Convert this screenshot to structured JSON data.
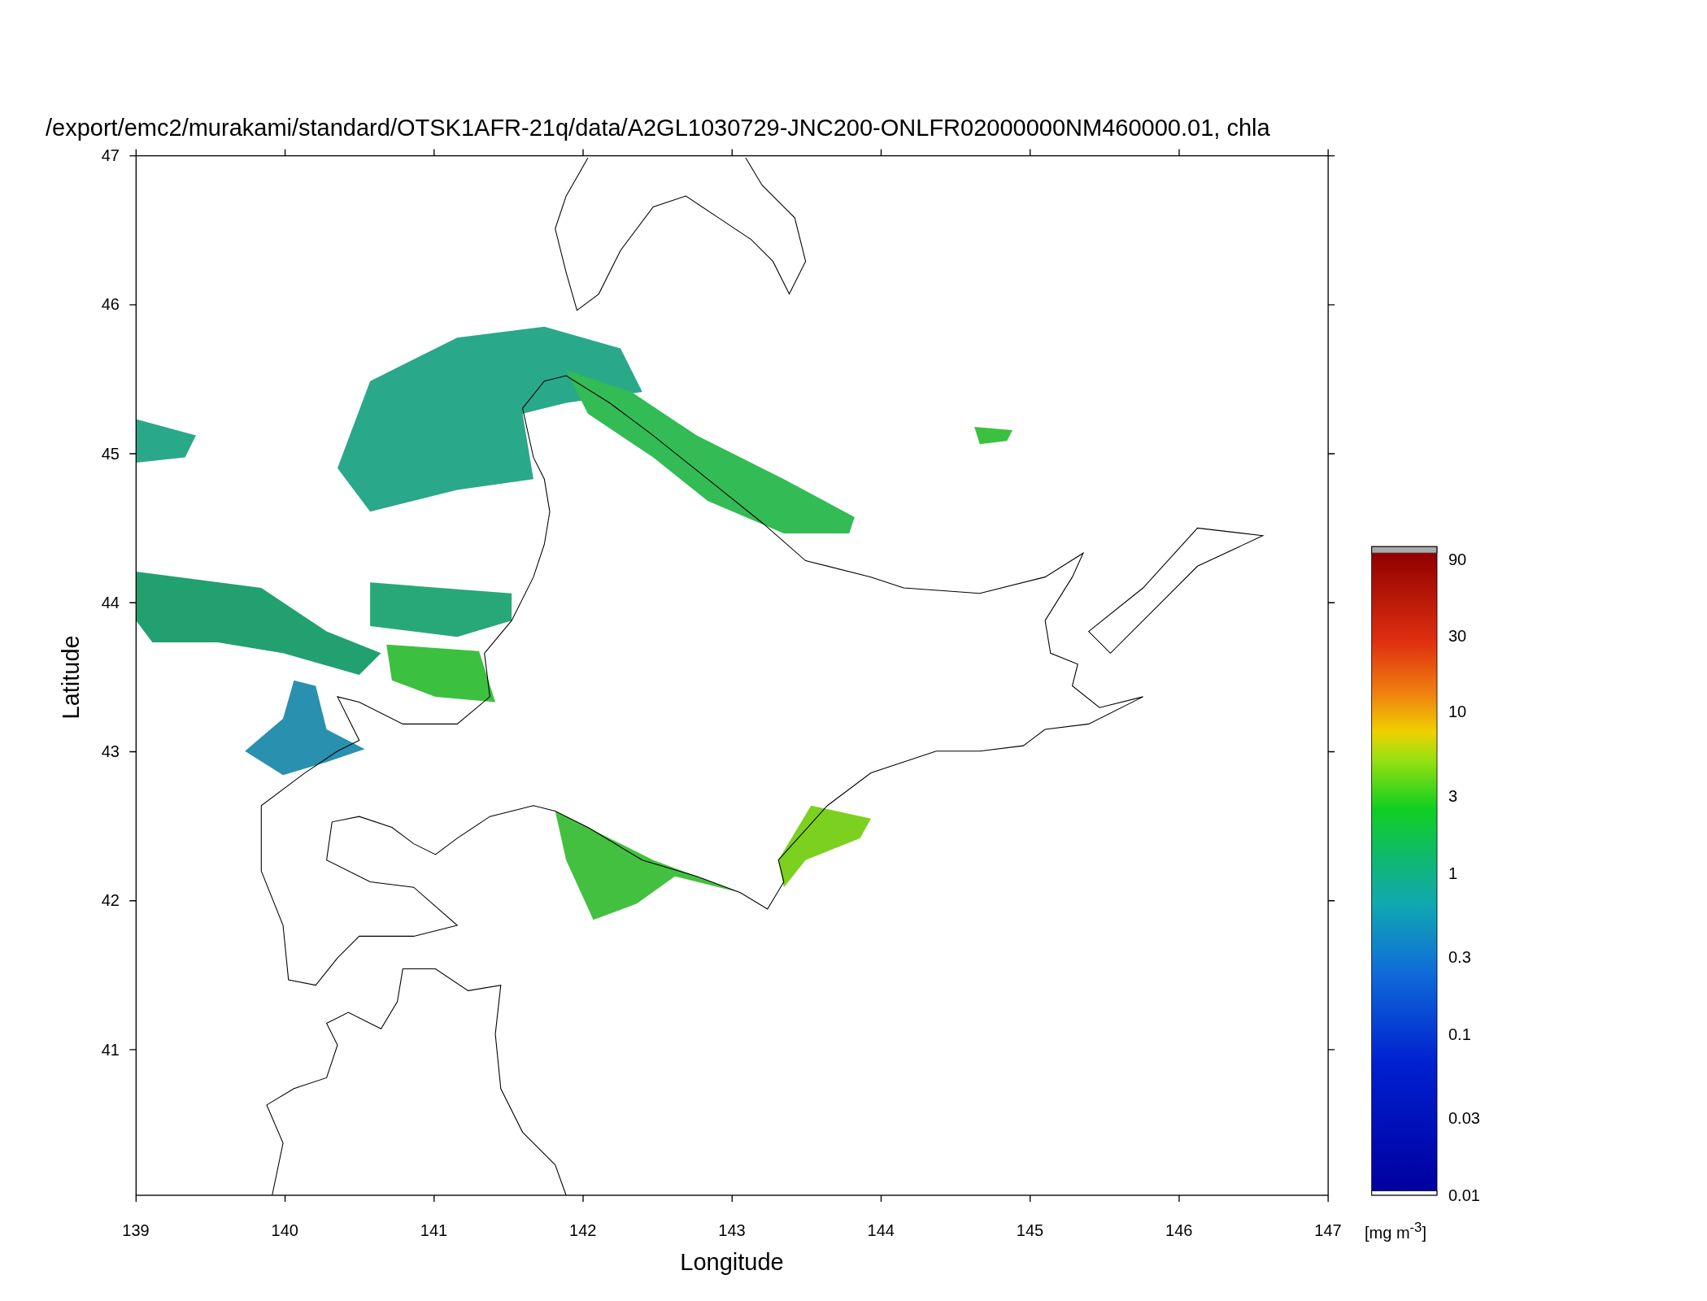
{
  "title": "/export/emc2/murakami/standard/OTSK1AFR-21q/data/A2GL1030729-JNC200-ONLFR02000000NM460000.01, chla",
  "x_axis": {
    "label": "Longitude",
    "ticks": [
      "139",
      "140",
      "141",
      "142",
      "143",
      "144",
      "145",
      "146",
      "147"
    ]
  },
  "y_axis": {
    "label": "Latitude",
    "ticks": [
      "47",
      "46",
      "45",
      "44",
      "43",
      "42",
      "41"
    ]
  },
  "colorbar": {
    "ticks": [
      "90",
      "30",
      "10",
      "3",
      "1",
      "0.3",
      "0.1",
      "0.03",
      "0.01"
    ],
    "unit": "[mg m$^{-3}$]"
  }
}
